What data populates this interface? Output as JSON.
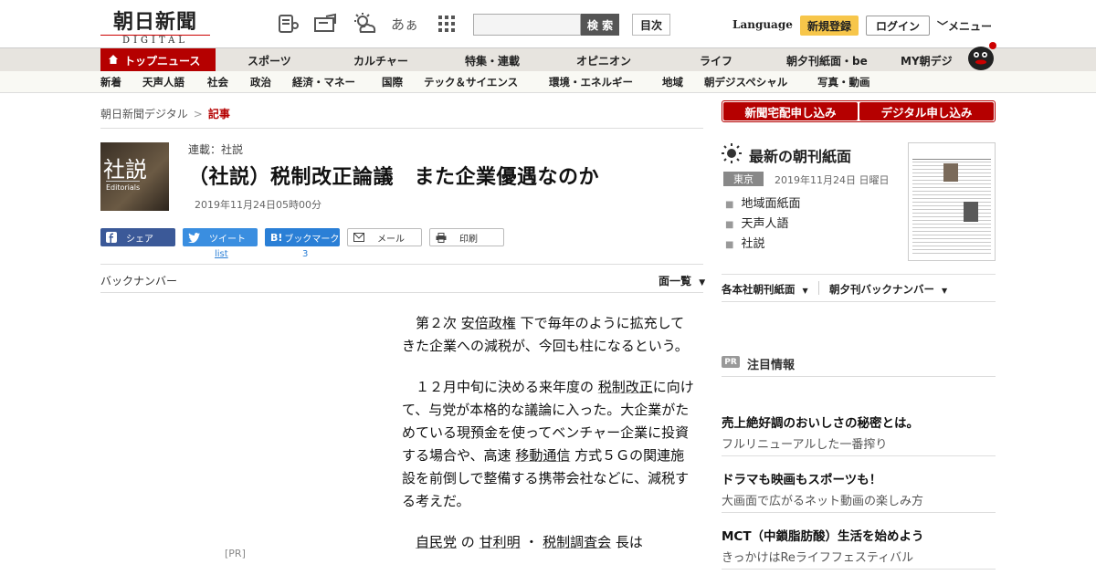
{
  "header": {
    "logo_main": "朝日新聞",
    "logo_sub": "DIGITAL",
    "search_button": "検 索",
    "toc_button": "目次",
    "language": "Language",
    "register": "新規登録",
    "login": "ログイン",
    "menu": "メニュー",
    "fontsize_label": "あぁ"
  },
  "category_nav": [
    {
      "label": "トップニュース",
      "active": true
    },
    {
      "label": "スポーツ"
    },
    {
      "label": "カルチャー"
    },
    {
      "label": "特集・連載"
    },
    {
      "label": "オピニオン"
    },
    {
      "label": "ライフ"
    },
    {
      "label": "朝夕刊紙面・be"
    },
    {
      "label": "MY朝デジ"
    }
  ],
  "sub_nav": [
    "新着",
    "天声人語",
    "社会",
    "政治",
    "経済・マネー",
    "国際",
    "テック＆サイエンス",
    "環境・エネルギー",
    "地域",
    "朝デジスペシャル",
    "写真・動画"
  ],
  "breadcrumb": {
    "home": "朝日新聞デジタル",
    "sep": ">",
    "current": "記事"
  },
  "article": {
    "thumb_kanji": "社説",
    "thumb_en": "Editorials",
    "series": "連載：社説",
    "headline": "（社説）税制改正論議　また企業優遇なのか",
    "date": "2019年11月24日05時00分",
    "share": {
      "facebook": "シェア",
      "twitter": "ツイート",
      "twitter_count": "list",
      "hatena": "ブックマーク",
      "hatena_count": "3",
      "mail": "メール",
      "print": "印刷"
    },
    "backnumber": "バックナンバー",
    "page_index": "面一覧",
    "pr_label": "[PR]",
    "paragraphs": [
      {
        "pre": "　第２次 ",
        "link": "安倍政権",
        "post": " 下で毎年のように拡充してきた企業への減税が、今回も柱になるという。"
      },
      {
        "pre": "　１２月中旬に決める来年度の ",
        "link": "税制改正",
        "post": "に向けて、与党が本格的な議論に入った。大企業がためている現預金を使ってベンチャー企業に投資する場合や、高速 ",
        "link2": "移動通信",
        "post2": " 方式５Ｇの関連施設を前倒しで整備する携帯会社などに、減税する考えだ。"
      },
      {
        "pre": "　",
        "link": "自民党",
        "post": " の ",
        "link2": "甘利明",
        "post2": " ・ ",
        "link3": "税制調査会",
        "post3": " 長は"
      }
    ]
  },
  "sidebar": {
    "subscribe_home": "新聞宅配申し込み",
    "subscribe_digital": "デジタル申し込み",
    "latest_title": "最新の朝刊紙面",
    "region": "東京",
    "latest_date": "2019年11月24日 日曜日",
    "latest_links": [
      "地域面紙面",
      "天声人語",
      "社説"
    ],
    "dropdown_morning": "各本社朝刊紙面",
    "dropdown_backnumber": "朝夕刊バックナンバー",
    "pr_badge": "PR",
    "pr_title": "注目情報",
    "pr_items": [
      {
        "headline": "売上絶好調のおいしさの秘密とは。",
        "sub": "フルリニューアルした一番搾り"
      },
      {
        "headline": "ドラマも映画もスポーツも！",
        "sub": "大画面で広がるネット動画の楽しみ方"
      },
      {
        "headline": "MCT（中鎖脂肪酸）生活を始めよう",
        "sub": "きっかけはReライフフェスティバル"
      }
    ]
  },
  "colors": {
    "brand_red": "#b50000",
    "register_yellow": "#f7c64a",
    "facebook": "#3b5998",
    "twitter": "#3a8ee0"
  }
}
